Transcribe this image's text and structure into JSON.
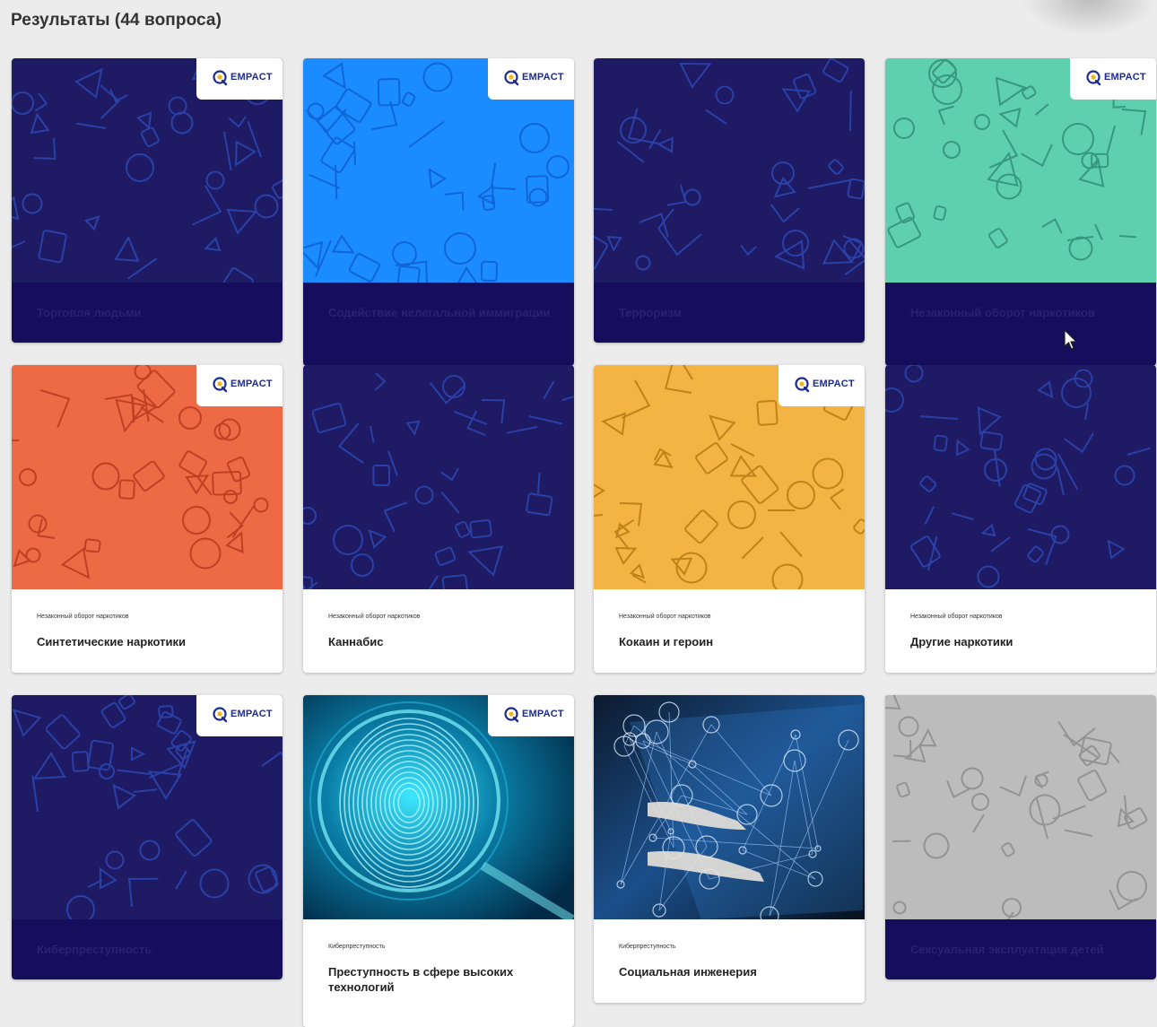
{
  "page": {
    "title": "Результаты (44 вопроса)"
  },
  "badge_text": "EMPACT",
  "colors": {
    "navy": "#1c1760",
    "blue": "#1e90ff",
    "teal": "#5fcfae",
    "orange": "#ee6b47",
    "yellow": "#f2b544",
    "gray": "#b9b8b8",
    "dark_footer": "#160e5c"
  },
  "cards": [
    {
      "title": "Торговля людьми",
      "category": "",
      "style": "dark",
      "bg": "navy",
      "badge": true,
      "icon": "human-trafficking-pattern"
    },
    {
      "title": "Содействие нелегальной иммиграции",
      "category": "",
      "style": "dark",
      "bg": "blue",
      "badge": true,
      "icon": "immigration-pattern"
    },
    {
      "title": "Терроризм",
      "category": "",
      "style": "dark",
      "bg": "navy",
      "badge": false,
      "icon": "terrorism-pattern"
    },
    {
      "title": "Незаконный оборот наркотиков",
      "category": "",
      "style": "dark",
      "bg": "teal",
      "badge": true,
      "icon": "drugs-pattern"
    },
    {
      "title": "Синтетические наркотики",
      "category": "Незаконный оборот наркотиков",
      "style": "light",
      "bg": "orange",
      "badge": true,
      "icon": "synthetic-drugs-pattern"
    },
    {
      "title": "Каннабис",
      "category": "Незаконный оборот наркотиков",
      "style": "light",
      "bg": "navy",
      "badge": false,
      "icon": "cannabis-pattern"
    },
    {
      "title": "Кокаин и героин",
      "category": "Незаконный оборот наркотиков",
      "style": "light",
      "bg": "yellow",
      "badge": true,
      "icon": "cocaine-heroin-pattern"
    },
    {
      "title": "Другие наркотики",
      "category": "Незаконный оборот наркотиков",
      "style": "light",
      "bg": "navy",
      "badge": false,
      "icon": "other-drugs-pattern"
    },
    {
      "title": "Киберпреступность",
      "category": "",
      "style": "dark",
      "bg": "navy",
      "badge": true,
      "icon": "cybercrime-pattern"
    },
    {
      "title": "Преступность в сфере высоких технологий",
      "category": "Киберпреступность",
      "style": "light",
      "bg": "fingerprint",
      "badge": true,
      "icon": "fingerprint-photo"
    },
    {
      "title": "Социальная инженерия",
      "category": "Киберпреступность",
      "style": "light",
      "bg": "network",
      "badge": false,
      "icon": "network-photo"
    },
    {
      "title": "Сексуальная эксплуатация детей",
      "category": "",
      "style": "dark",
      "bg": "gray",
      "badge": false,
      "icon": "child-exploitation-pattern"
    }
  ]
}
